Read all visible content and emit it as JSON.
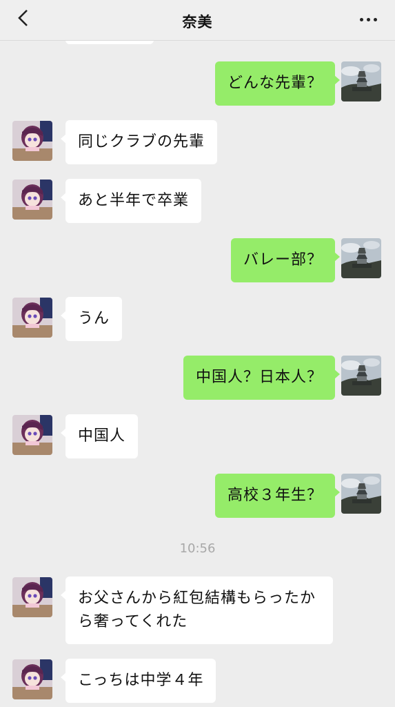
{
  "header": {
    "title": "奈美",
    "back_icon": "chevron-left-icon",
    "more_icon": "more-dots-icon"
  },
  "timestamp": "10:56",
  "messages": [
    {
      "from": "me",
      "text": "どんな先輩？"
    },
    {
      "from": "other",
      "text": "同じクラブの先輩"
    },
    {
      "from": "other",
      "text": "あと半年で卒業"
    },
    {
      "from": "me",
      "text": "バレー部？"
    },
    {
      "from": "other",
      "text": "うん"
    },
    {
      "from": "me",
      "text": "中国人？日本人？"
    },
    {
      "from": "other",
      "text": "中国人"
    },
    {
      "from": "me",
      "text": "高校３年生？"
    },
    {
      "from": "other",
      "text": "お父さんから紅包結構もらったから奢ってくれた"
    },
    {
      "from": "other",
      "text": "こっちは中学４年"
    }
  ],
  "colors": {
    "background": "#ededed",
    "outgoing_bubble": "#95ec69",
    "incoming_bubble": "#ffffff"
  }
}
